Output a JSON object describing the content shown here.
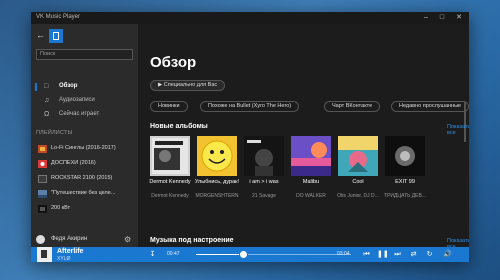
{
  "window": {
    "title": "VK Music Player"
  },
  "sidebar": {
    "search_placeholder": "Поиск",
    "nav": [
      {
        "label": "Обзор",
        "icon": "square-icon",
        "active": true
      },
      {
        "label": "Аудиозаписи",
        "icon": "music-note-icon",
        "active": false
      },
      {
        "label": "Сейчас играет",
        "icon": "headphones-icon",
        "active": false
      }
    ],
    "playlists_heading": "ПЛЕЙЛИСТЫ",
    "playlists": [
      {
        "label": "Lo-Fi Синглы (2016-2017)"
      },
      {
        "label": "ДОСПЕХИ (2016)"
      },
      {
        "label": "ROCKSTAR 2100 (2015)"
      },
      {
        "label": "\"Путешествие без целе..."
      },
      {
        "label": "200 кВт"
      }
    ],
    "user_name": "Федя Акирин"
  },
  "main": {
    "title": "Обзор",
    "pills": [
      "Специально для Вас",
      "Новинки",
      "Похоже на Bullet (Хуго The Hero)",
      "Чарт ВКонтакте",
      "Недавно прослушанные"
    ],
    "new_albums_title": "Новые альбомы",
    "show_all": "Показать все",
    "albums": [
      {
        "title": "Dermot Kennedy",
        "artist": "Dermot Kennedy"
      },
      {
        "title": "Улыбнись, дурак!",
        "artist": "MORGENSHTERN"
      },
      {
        "title": "i am > i was",
        "artist": "21 Savage"
      },
      {
        "title": "Malibu",
        "artist": "DO WALKER"
      },
      {
        "title": "Cool",
        "artist": "Otis Junior, DJ D..."
      },
      {
        "title": "EXIT 99",
        "artist": "ТРИДЦАТЬ ДЕВ..."
      }
    ],
    "mood_title": "Музыка под настроение",
    "mood_show_all": "Показать все"
  },
  "player": {
    "title": "Afterlife",
    "artist": "XYLØ",
    "time_current": "00:47",
    "time_total": "03:04",
    "progress": 0.3,
    "accent": "#1b78d0"
  }
}
